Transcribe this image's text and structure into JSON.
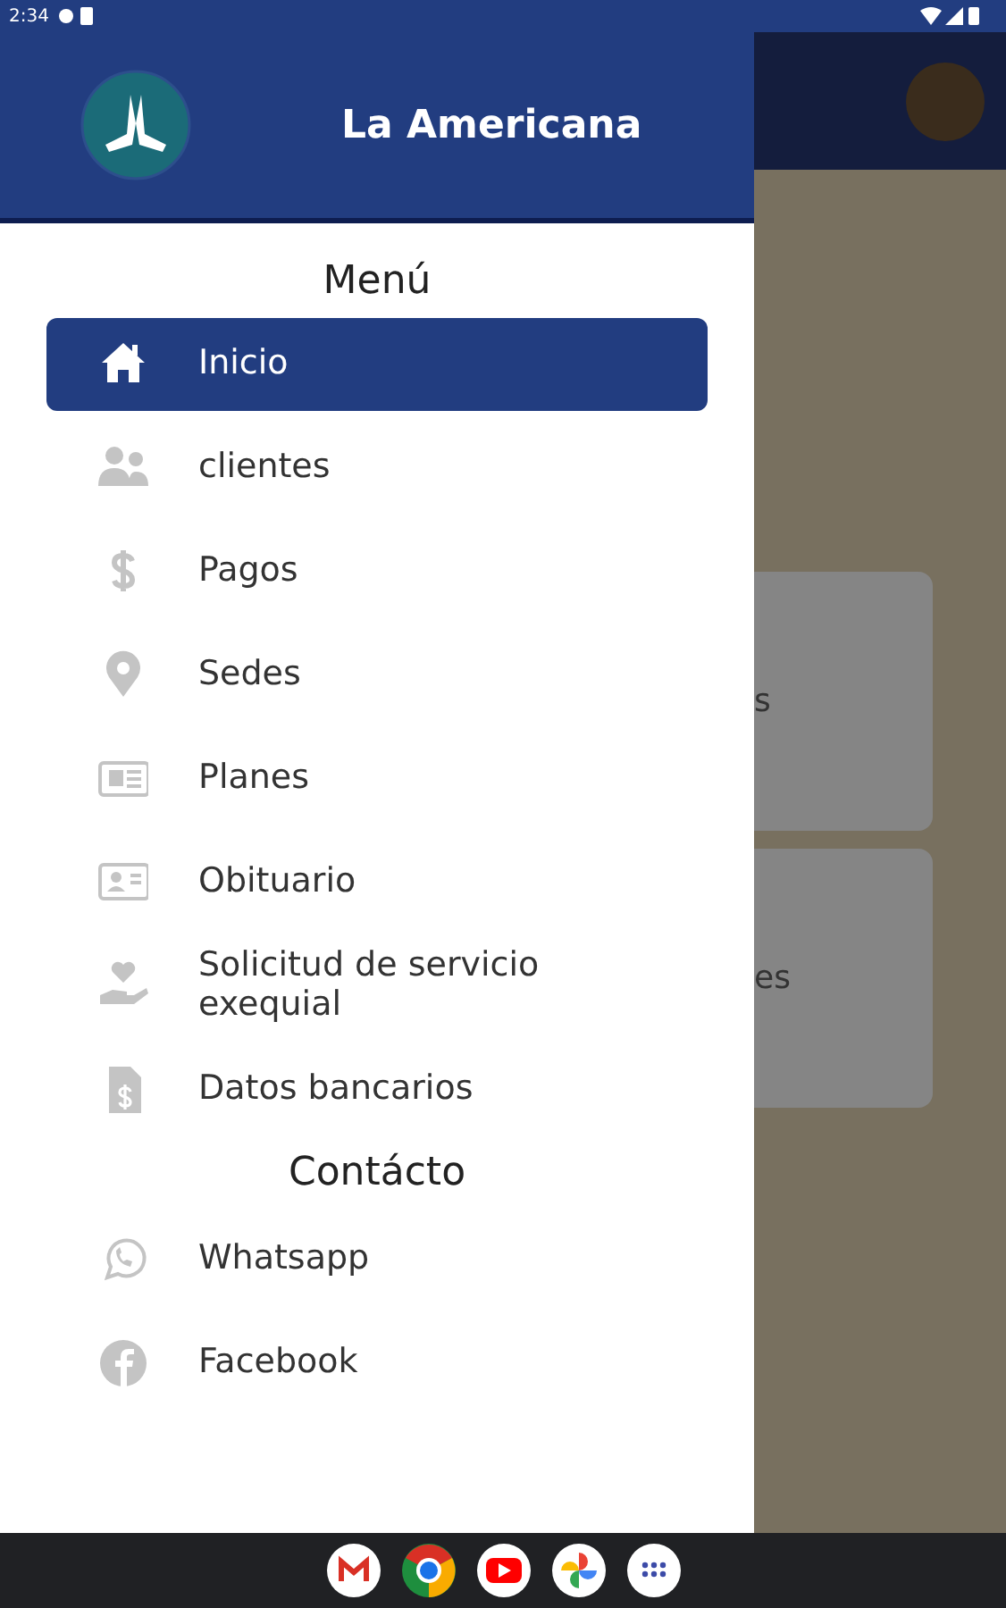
{
  "status_bar": {
    "time": "2:34"
  },
  "drawer": {
    "title": "La Americana",
    "menu_heading": "Menú",
    "menu_items": [
      {
        "label": "Inicio",
        "selected": true
      },
      {
        "label": "clientes",
        "selected": false
      },
      {
        "label": "Pagos",
        "selected": false
      },
      {
        "label": "Sedes",
        "selected": false
      },
      {
        "label": "Planes",
        "selected": false
      },
      {
        "label": "Obituario",
        "selected": false
      },
      {
        "label": "Solicitud de servicio exequial",
        "selected": false
      },
      {
        "label": "Datos bancarios",
        "selected": false
      }
    ],
    "contact_heading": "Contácto",
    "contact_items": [
      {
        "label": "Whatsapp"
      },
      {
        "label": "Facebook"
      }
    ]
  },
  "background": {
    "cards": [
      {
        "text": "s"
      },
      {
        "text": "es"
      }
    ]
  }
}
